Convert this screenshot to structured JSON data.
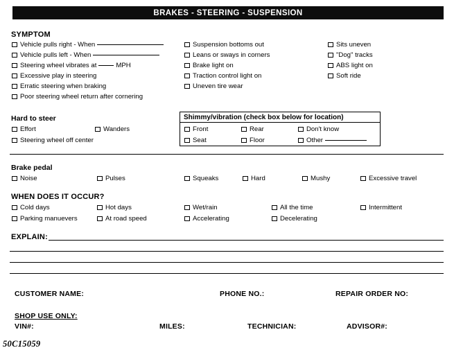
{
  "header": {
    "title": "BRAKES - STEERING - SUSPENSION"
  },
  "sections": {
    "symptom": {
      "heading": "SYMPTOM",
      "column1": [
        {
          "label": "Vehicle pulls right - When",
          "rule": "long"
        },
        {
          "label": "Vehicle pulls left - When",
          "rule": "long"
        },
        {
          "label": "Steering wheel vibrates at",
          "rule": "short",
          "label_after": "MPH"
        },
        {
          "label": "Excessive play in steering"
        },
        {
          "label": "Erratic steering when braking"
        },
        {
          "label": "Poor steering wheel return after cornering"
        }
      ],
      "column2": [
        {
          "label": "Suspension bottoms out"
        },
        {
          "label": "Leans or sways in corners"
        },
        {
          "label": "Brake light on"
        },
        {
          "label": "Traction control light on"
        },
        {
          "label": "Uneven tire wear"
        }
      ],
      "column3": [
        {
          "label": "Sits uneven"
        },
        {
          "label": "\"Dog\" tracks"
        },
        {
          "label": "ABS light on"
        },
        {
          "label": "Soft ride"
        }
      ]
    },
    "hard_to_steer": {
      "heading": "Hard to steer",
      "items": [
        {
          "label": "Effort"
        },
        {
          "label": "Wanders"
        },
        {
          "label": "Steering wheel off center"
        }
      ]
    },
    "shimmy": {
      "heading": "Shimmy/vibration (check box below for location)",
      "items": [
        {
          "label": "Front"
        },
        {
          "label": "Rear"
        },
        {
          "label": "Don't know"
        },
        {
          "label": "Seat"
        },
        {
          "label": "Floor"
        },
        {
          "label": "Other",
          "rule": "med"
        }
      ]
    },
    "brake_pedal": {
      "heading": "Brake pedal",
      "items": [
        {
          "label": "Noise"
        },
        {
          "label": "Pulses"
        },
        {
          "label": "Squeaks"
        },
        {
          "label": "Hard"
        },
        {
          "label": "Mushy"
        },
        {
          "label": "Excessive travel"
        }
      ]
    },
    "when_occurs": {
      "heading": "WHEN DOES IT OCCUR?",
      "row1": [
        {
          "label": "Cold days"
        },
        {
          "label": "Hot days"
        },
        {
          "label": "Wet/rain"
        },
        {
          "label": "All the time"
        },
        {
          "label": "Intermittent"
        }
      ],
      "row2": [
        {
          "label": "Parking manuevers"
        },
        {
          "label": "At road speed"
        },
        {
          "label": "Accelerating"
        },
        {
          "label": "Decelerating"
        }
      ]
    },
    "explain": {
      "label": "EXPLAIN:"
    }
  },
  "footer": {
    "customer_name": "CUSTOMER NAME:",
    "phone_no": "PHONE NO.:",
    "repair_order_no": "REPAIR ORDER NO:",
    "shop_use_only": "SHOP USE ONLY:",
    "vin": "VIN#:",
    "miles": "MILES:",
    "technician": "TECHNICIAN:",
    "advisor": "ADVISOR#:"
  },
  "figure_number": "50C15059"
}
